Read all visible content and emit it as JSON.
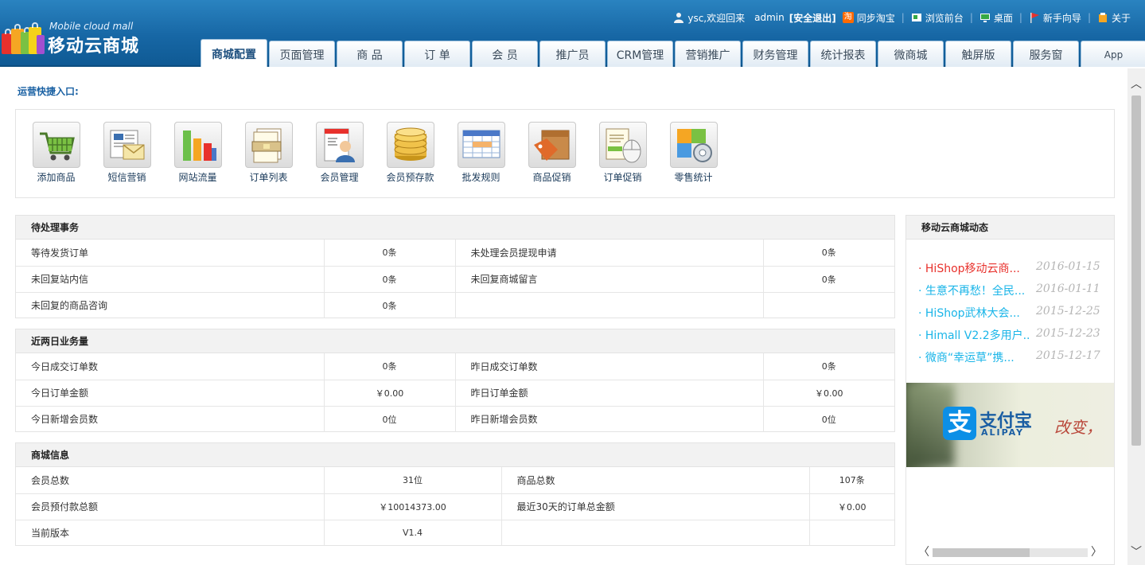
{
  "brand": {
    "subtitle": "Mobile cloud mall",
    "name": "移动云商城",
    "colors": [
      "#e8312c",
      "#f5a623",
      "#7ac143",
      "#1aa7e8",
      "#a34fd0",
      "#f5d21a"
    ]
  },
  "toplinks": {
    "user": "ysc,欢迎回来",
    "username": "admin",
    "logout": "[安全退出]",
    "sync_taobao": "同步淘宝",
    "browse_front": "浏览前台",
    "desktop": "桌面",
    "guide": "新手向导",
    "about": "关于"
  },
  "tabs": [
    {
      "label": "商城配置",
      "active": true
    },
    {
      "label": "页面管理"
    },
    {
      "label": "商 品"
    },
    {
      "label": "订 单"
    },
    {
      "label": "会 员"
    },
    {
      "label": "推广员"
    },
    {
      "label": "CRM管理"
    },
    {
      "label": "营销推广"
    },
    {
      "label": "财务管理"
    },
    {
      "label": "统计报表"
    },
    {
      "label": "微商城"
    },
    {
      "label": "触屏版"
    },
    {
      "label": "服务窗"
    },
    {
      "label": "App"
    }
  ],
  "quick": {
    "title": "运营快捷入口:",
    "items": [
      {
        "label": "添加商品",
        "icon": "cart-icon"
      },
      {
        "label": "短信营销",
        "icon": "sms-mail-icon"
      },
      {
        "label": "网站流量",
        "icon": "bar-chart-icon"
      },
      {
        "label": "订单列表",
        "icon": "order-list-icon"
      },
      {
        "label": "会员管理",
        "icon": "member-icon"
      },
      {
        "label": "会员预存款",
        "icon": "coins-icon"
      },
      {
        "label": "批发规则",
        "icon": "table-icon"
      },
      {
        "label": "商品促销",
        "icon": "price-tag-box-icon"
      },
      {
        "label": "订单促销",
        "icon": "order-mouse-icon"
      },
      {
        "label": "零售统计",
        "icon": "puzzle-gear-icon"
      }
    ]
  },
  "pending": {
    "title": "待处理事务",
    "rows": [
      [
        "等待发货订单",
        "0条",
        "未处理会员提现申请",
        "0条"
      ],
      [
        "未回复站内信",
        "0条",
        "未回复商城留言",
        "0条"
      ],
      [
        "未回复的商品咨询",
        "0条",
        "",
        ""
      ]
    ]
  },
  "business": {
    "title": "近两日业务量",
    "rows": [
      [
        "今日成交订单数",
        "0条",
        "昨日成交订单数",
        "0条"
      ],
      [
        "今日订单金额",
        "￥0.00",
        "昨日订单金额",
        "￥0.00"
      ],
      [
        "今日新增会员数",
        "0位",
        "昨日新增会员数",
        "0位"
      ]
    ]
  },
  "shopinfo": {
    "title": "商城信息",
    "rows": [
      [
        "会员总数",
        "31位",
        "商品总数",
        "107条"
      ],
      [
        "会员预付款总额",
        "￥10014373.00",
        "最近30天的订单总金额",
        "￥0.00"
      ],
      [
        "当前版本",
        "V1.4",
        "",
        ""
      ]
    ]
  },
  "news": {
    "title": "移动云商城动态",
    "items": [
      {
        "title": "· HiShop移动云商...",
        "date": "2016-01-15",
        "red": true
      },
      {
        "title": "· 生意不再愁！全民...",
        "date": "2016-01-11"
      },
      {
        "title": "· HiShop武林大会...",
        "date": "2015-12-25"
      },
      {
        "title": "· Himall V2.2多用户...",
        "date": "2015-12-23"
      },
      {
        "title": "· 微商“幸运草”携...",
        "date": "2015-12-17"
      }
    ]
  },
  "banner": {
    "logo_char": "支",
    "brand_cn": "支付宝",
    "brand_en": "ALIPAY",
    "slogan": "改变，"
  },
  "scroll": {
    "up": "︿",
    "down": "﹀",
    "left": "〈",
    "right": "〉"
  }
}
